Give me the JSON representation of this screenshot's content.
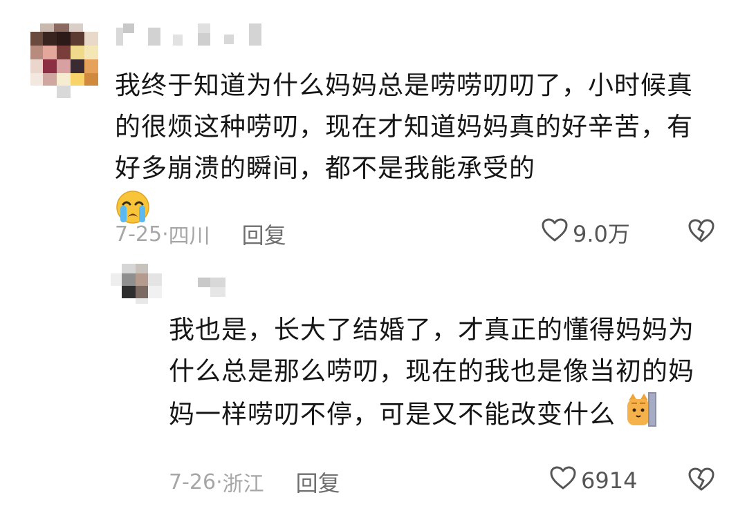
{
  "comments": [
    {
      "text": "我终于知道为什么妈妈总是唠唠叨叨了，小时候真的很烦这种唠叨，现在才知道妈妈真的好辛苦，有好多崩溃的瞬间，都不是我能承受的",
      "emoji": "crying-face-emoji",
      "date": "7-25",
      "separator": "·",
      "location": "四川",
      "reply_label": "回复",
      "like_count": "9.0万",
      "colors": {
        "text": "#161616",
        "meta": "#a6a6a6",
        "reply": "#6f6f6f"
      }
    },
    {
      "text": "我也是，长大了结婚了，才真正的懂得妈妈为什么总是那么唠叨，现在的我也是像当初的妈妈一样唠叨不停，可是又不能改变什么",
      "emoji": "cat-peeking-emoji",
      "date": "7-26",
      "separator": "·",
      "location": "浙江",
      "reply_label": "回复",
      "like_count": "6914"
    }
  ]
}
